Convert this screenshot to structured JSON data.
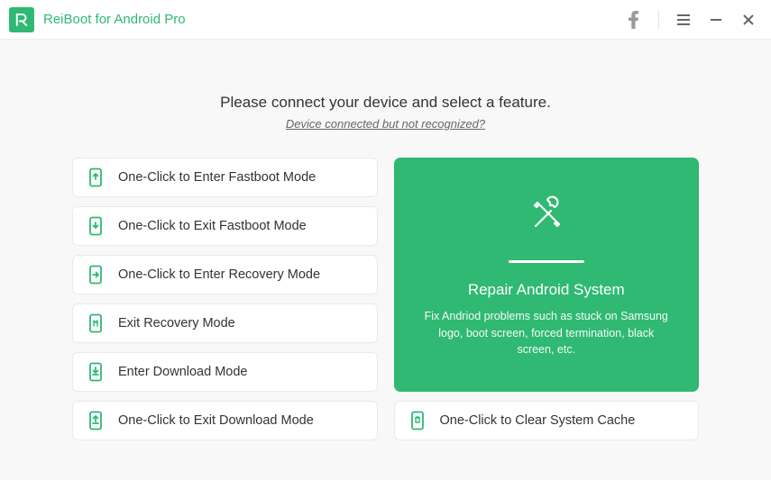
{
  "header": {
    "app_title": "ReiBoot for Android Pro"
  },
  "prompt": {
    "main": "Please connect your device and select a feature.",
    "sub": "Device connected but not recognized?"
  },
  "left_options": [
    {
      "icon": "phone-arrow-up",
      "label": "One-Click to Enter Fastboot Mode"
    },
    {
      "icon": "phone-arrow-down",
      "label": "One-Click to Exit Fastboot Mode"
    },
    {
      "icon": "phone-arrow-right",
      "label": "One-Click to Enter Recovery Mode"
    },
    {
      "icon": "phone-refresh",
      "label": "Exit Recovery Mode"
    },
    {
      "icon": "phone-download",
      "label": "Enter Download Mode"
    },
    {
      "icon": "phone-download-out",
      "label": "One-Click to Exit Download Mode"
    }
  ],
  "repair_card": {
    "title": "Repair Android System",
    "desc": "Fix Andriod problems such as stuck on Samsung logo, boot screen, forced termination, black screen, etc."
  },
  "clear_cache": {
    "icon": "phone-trash",
    "label": "One-Click to Clear System Cache"
  }
}
